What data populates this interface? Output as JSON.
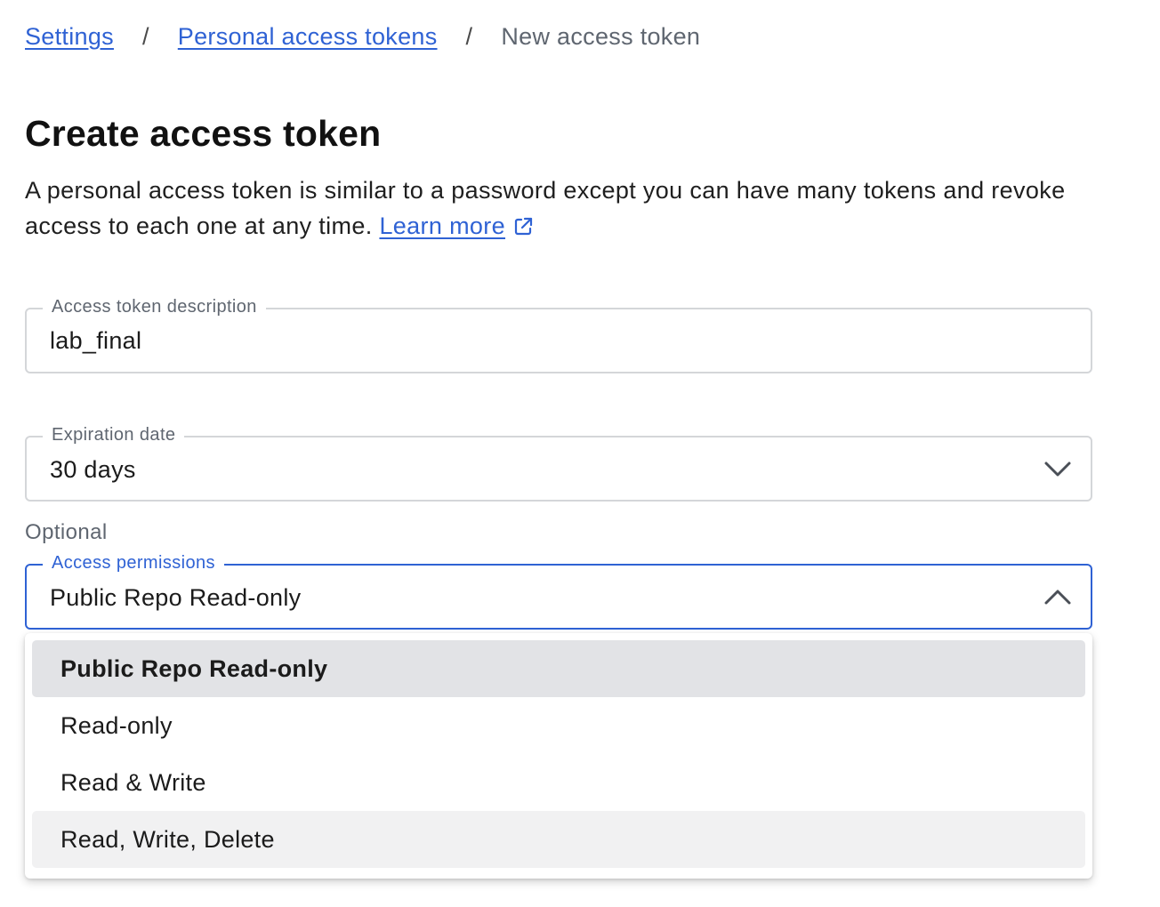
{
  "breadcrumb": {
    "settings": "Settings",
    "separator": "/",
    "tokens": "Personal access tokens",
    "current": "New access token"
  },
  "page": {
    "title": "Create access token",
    "intro": "A personal access token is similar to a password except you can have many tokens and revoke access to each one at any time.",
    "learn_more": "Learn more",
    "learn_more_icon": "external-link-icon"
  },
  "description_field": {
    "label": "Access token description",
    "value": "lab_final"
  },
  "expiration_field": {
    "label": "Expiration date",
    "value": "30 days",
    "icon": "chevron-down-icon"
  },
  "optional_label": "Optional",
  "permissions_field": {
    "label": "Access permissions",
    "value": "Public Repo Read-only",
    "icon": "chevron-up-icon",
    "state": "open",
    "options": [
      {
        "label": "Public Repo Read-only",
        "selected": true
      },
      {
        "label": "Read-only",
        "selected": false
      },
      {
        "label": "Read & Write",
        "selected": false
      },
      {
        "label": "Read, Write, Delete",
        "selected": false,
        "hovered": true
      }
    ]
  },
  "colors": {
    "accent": "#2f62d4",
    "muted_text": "#5f6670",
    "border": "#d4d6d9",
    "selected_option_bg": "#e2e3e6",
    "hover_option_bg": "#f1f1f2"
  }
}
